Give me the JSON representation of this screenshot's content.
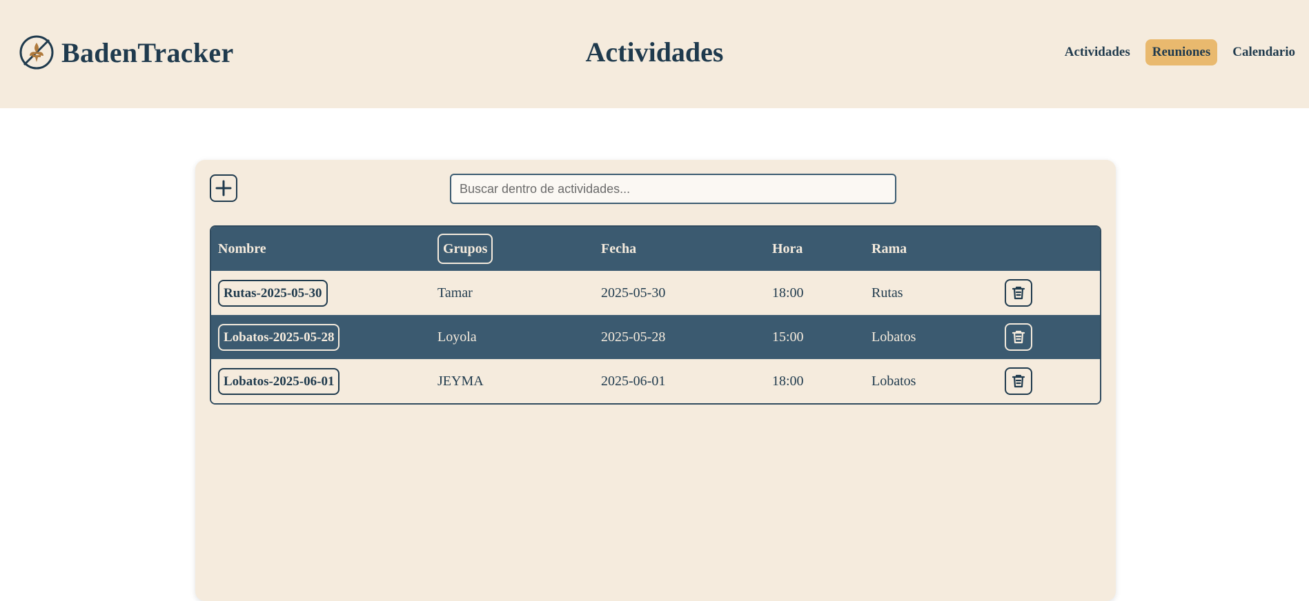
{
  "header": {
    "brand": "BadenTracker",
    "title": "Actividades",
    "nav": [
      {
        "label": "Actividades",
        "active": false
      },
      {
        "label": "Reuniones",
        "active": true
      },
      {
        "label": "Calendario",
        "active": false
      }
    ]
  },
  "search": {
    "placeholder": "Buscar dentro de actividades...",
    "value": ""
  },
  "table": {
    "columns": [
      "Nombre",
      "Grupos",
      "Fecha",
      "Hora",
      "Rama"
    ],
    "rows": [
      {
        "nombre": "Rutas-2025-05-30",
        "grupos": "Tamar",
        "fecha": "2025-05-30",
        "hora": "18:00",
        "rama": "Rutas"
      },
      {
        "nombre": "Lobatos-2025-05-28",
        "grupos": "Loyola",
        "fecha": "2025-05-28",
        "hora": "15:00",
        "rama": "Lobatos"
      },
      {
        "nombre": "Lobatos-2025-06-01",
        "grupos": "JEYMA",
        "fecha": "2025-06-01",
        "hora": "18:00",
        "rama": "Lobatos"
      }
    ]
  },
  "icons": {
    "logo": "compass-fleur-de-lis-icon",
    "add": "plus-icon",
    "delete": "trash-icon"
  },
  "colors": {
    "primary": "#1f3a4d",
    "header_bg": "#f5ebdd",
    "accent": "#e9b96e",
    "table_dark": "#3b5a70"
  }
}
